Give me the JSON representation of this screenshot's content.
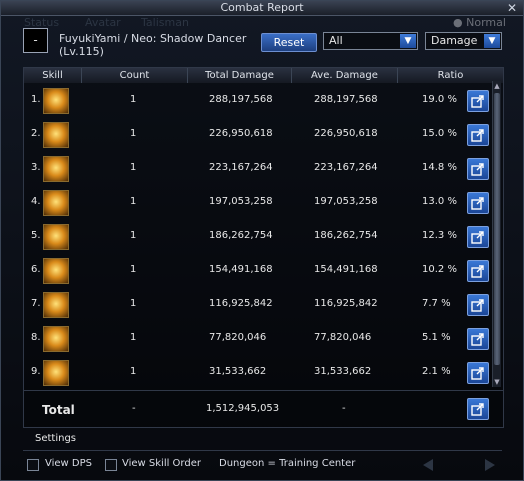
{
  "window": {
    "title": "Combat Report",
    "close": "✕"
  },
  "background_hints": {
    "status": "Status",
    "avatar": "Avatar",
    "talisman": "Talisman",
    "normal": "Normal"
  },
  "character": {
    "box_label": "-",
    "name_line1": "FuyukiYami / Neo: Shadow Dancer",
    "name_line2": "(Lv.115)"
  },
  "controls": {
    "reset_label": "Reset",
    "filter_value": "All",
    "metric_value": "Damage"
  },
  "columns": [
    "Skill",
    "Count",
    "Total Damage",
    "Ave. Damage",
    "Ratio"
  ],
  "rows": [
    {
      "index": "1.",
      "count": "1",
      "total": "288,197,568",
      "ave": "288,197,568",
      "ratio": "19.0 %"
    },
    {
      "index": "2.",
      "count": "1",
      "total": "226,950,618",
      "ave": "226,950,618",
      "ratio": "15.0 %"
    },
    {
      "index": "3.",
      "count": "1",
      "total": "223,167,264",
      "ave": "223,167,264",
      "ratio": "14.8 %"
    },
    {
      "index": "4.",
      "count": "1",
      "total": "197,053,258",
      "ave": "197,053,258",
      "ratio": "13.0 %"
    },
    {
      "index": "5.",
      "count": "1",
      "total": "186,262,754",
      "ave": "186,262,754",
      "ratio": "12.3 %"
    },
    {
      "index": "6.",
      "count": "1",
      "total": "154,491,168",
      "ave": "154,491,168",
      "ratio": "10.2 %"
    },
    {
      "index": "7.",
      "count": "1",
      "total": "116,925,842",
      "ave": "116,925,842",
      "ratio": "7.7 %"
    },
    {
      "index": "8.",
      "count": "1",
      "total": "77,820,046",
      "ave": "77,820,046",
      "ratio": "5.1 %"
    },
    {
      "index": "9.",
      "count": "1",
      "total": "31,533,662",
      "ave": "31,533,662",
      "ratio": "2.1 %"
    }
  ],
  "total": {
    "label": "Total",
    "count": "-",
    "total": "1,512,945,053",
    "ave": "-"
  },
  "footer": {
    "settings": "Settings",
    "view_dps": "View DPS",
    "view_skill_order": "View Skill Order",
    "dungeon": "Dungeon = Training Center"
  }
}
